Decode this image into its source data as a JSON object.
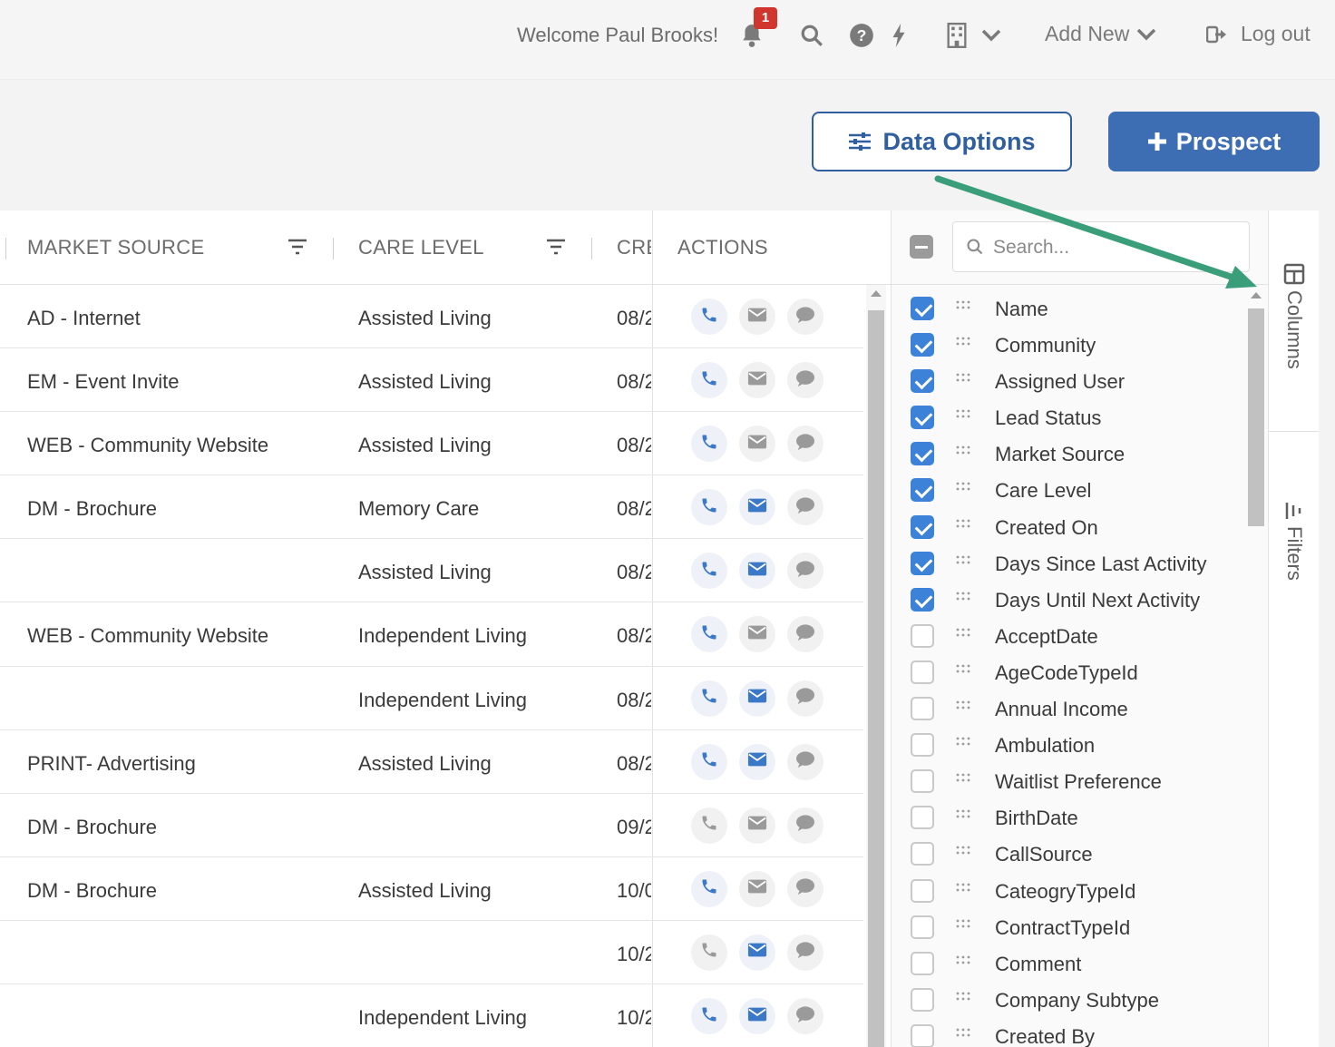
{
  "header": {
    "welcome": "Welcome Paul Brooks!",
    "notification_count": "1",
    "add_new_label": "Add New",
    "logout_label": "Log out"
  },
  "toolbar": {
    "data_options_label": "Data Options",
    "prospect_label": "Prospect"
  },
  "grid": {
    "columns": [
      "MARKET SOURCE",
      "CARE LEVEL",
      "CRE",
      "ACTIONS"
    ],
    "rows": [
      {
        "market_source": "AD - Internet",
        "care_level": "Assisted Living",
        "created": "08/2",
        "mail_active": false
      },
      {
        "market_source": "EM - Event Invite",
        "care_level": "Assisted Living",
        "created": "08/2",
        "mail_active": false
      },
      {
        "market_source": "WEB - Community Website",
        "care_level": "Assisted Living",
        "created": "08/2",
        "mail_active": false
      },
      {
        "market_source": "DM - Brochure",
        "care_level": "Memory Care",
        "created": "08/2",
        "mail_active": true
      },
      {
        "market_source": "",
        "care_level": "Assisted Living",
        "created": "08/2",
        "mail_active": true
      },
      {
        "market_source": "WEB - Community Website",
        "care_level": "Independent Living",
        "created": "08/2",
        "mail_active": false
      },
      {
        "market_source": "",
        "care_level": "Independent Living",
        "created": "08/2",
        "mail_active": true
      },
      {
        "market_source": "PRINT- Advertising",
        "care_level": "Assisted Living",
        "created": "08/2",
        "mail_active": true
      },
      {
        "market_source": "DM - Brochure",
        "care_level": "",
        "created": "09/2",
        "mail_active": false,
        "phone_active": false
      },
      {
        "market_source": "DM - Brochure",
        "care_level": "Assisted Living",
        "created": "10/0",
        "mail_active": false
      },
      {
        "market_source": "",
        "care_level": "",
        "created": "10/2",
        "mail_active": true,
        "phone_active": false
      },
      {
        "market_source": "",
        "care_level": "Independent Living",
        "created": "10/2",
        "mail_active": true
      }
    ]
  },
  "column_panel": {
    "search_placeholder": "Search...",
    "items": [
      {
        "label": "Name",
        "checked": true
      },
      {
        "label": "Community",
        "checked": true
      },
      {
        "label": "Assigned User",
        "checked": true
      },
      {
        "label": "Lead Status",
        "checked": true
      },
      {
        "label": "Market Source",
        "checked": true
      },
      {
        "label": "Care Level",
        "checked": true
      },
      {
        "label": "Created On",
        "checked": true
      },
      {
        "label": "Days Since Last Activity",
        "checked": true
      },
      {
        "label": "Days Until Next Activity",
        "checked": true
      },
      {
        "label": "AcceptDate",
        "checked": false
      },
      {
        "label": "AgeCodeTypeId",
        "checked": false
      },
      {
        "label": "Annual Income",
        "checked": false
      },
      {
        "label": "Ambulation",
        "checked": false
      },
      {
        "label": "Waitlist Preference",
        "checked": false
      },
      {
        "label": "BirthDate",
        "checked": false
      },
      {
        "label": "CallSource",
        "checked": false
      },
      {
        "label": "CateogryTypeId",
        "checked": false
      },
      {
        "label": "ContractTypeId",
        "checked": false
      },
      {
        "label": "Comment",
        "checked": false
      },
      {
        "label": "Company Subtype",
        "checked": false
      },
      {
        "label": "Created By",
        "checked": false
      }
    ]
  },
  "side_tabs": {
    "columns_label": "Columns",
    "filters_label": "Filters"
  },
  "colors": {
    "primary": "#3d6eb4",
    "checkbox_on": "#3b82d8",
    "badge": "#d0362d",
    "annotation_arrow": "#3a9e7a"
  }
}
